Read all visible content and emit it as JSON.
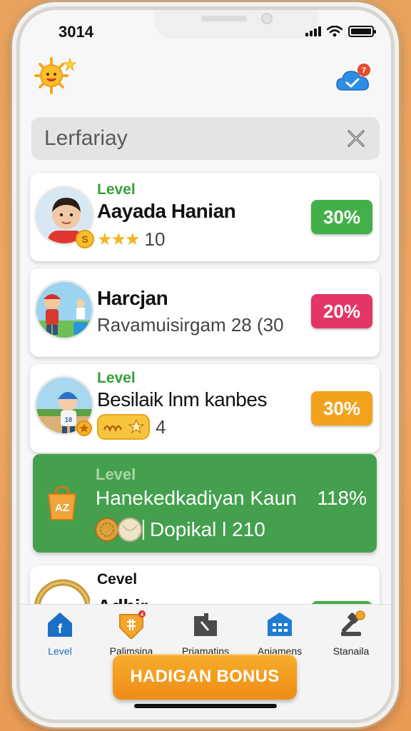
{
  "status": {
    "time": "3014"
  },
  "search": {
    "value": "Lerfariay"
  },
  "cards": [
    {
      "level_label": "Level",
      "name": "Aayada Hanian",
      "badge": "S",
      "stars": "★★★",
      "score": "10",
      "percent": "30%"
    },
    {
      "name": "Harcjan",
      "subtitle": "Ravamuisirgam 28 (30",
      "percent": "20%"
    },
    {
      "level_label": "Level",
      "name": "Besilaik lnm kanbes",
      "count": "4",
      "percent": "30%"
    },
    {
      "level_label": "Level",
      "name": "Hanekedkadiyan Kaun",
      "percent": "118%",
      "detail": "Dopikal l 210",
      "bag_label": "AZ"
    },
    {
      "level_label": "Cevel",
      "name": "Adbir"
    }
  ],
  "tabs": [
    {
      "label": "Level",
      "icon": "home-icon"
    },
    {
      "label": "Palimsina",
      "icon": "shield-icon",
      "badge": "4"
    },
    {
      "label": "Priamatins",
      "icon": "shop-icon"
    },
    {
      "label": "Aniamens",
      "icon": "building-icon"
    },
    {
      "label": "Stanaila",
      "icon": "hammer-icon"
    }
  ],
  "bonus_button": "HADIGAN BONUS",
  "notification_count": "7",
  "colors": {
    "green": "#42b048",
    "pink": "#e43666",
    "orange": "#f3a21e",
    "feature": "#44a04d",
    "tab_active": "#1b6fc4"
  }
}
